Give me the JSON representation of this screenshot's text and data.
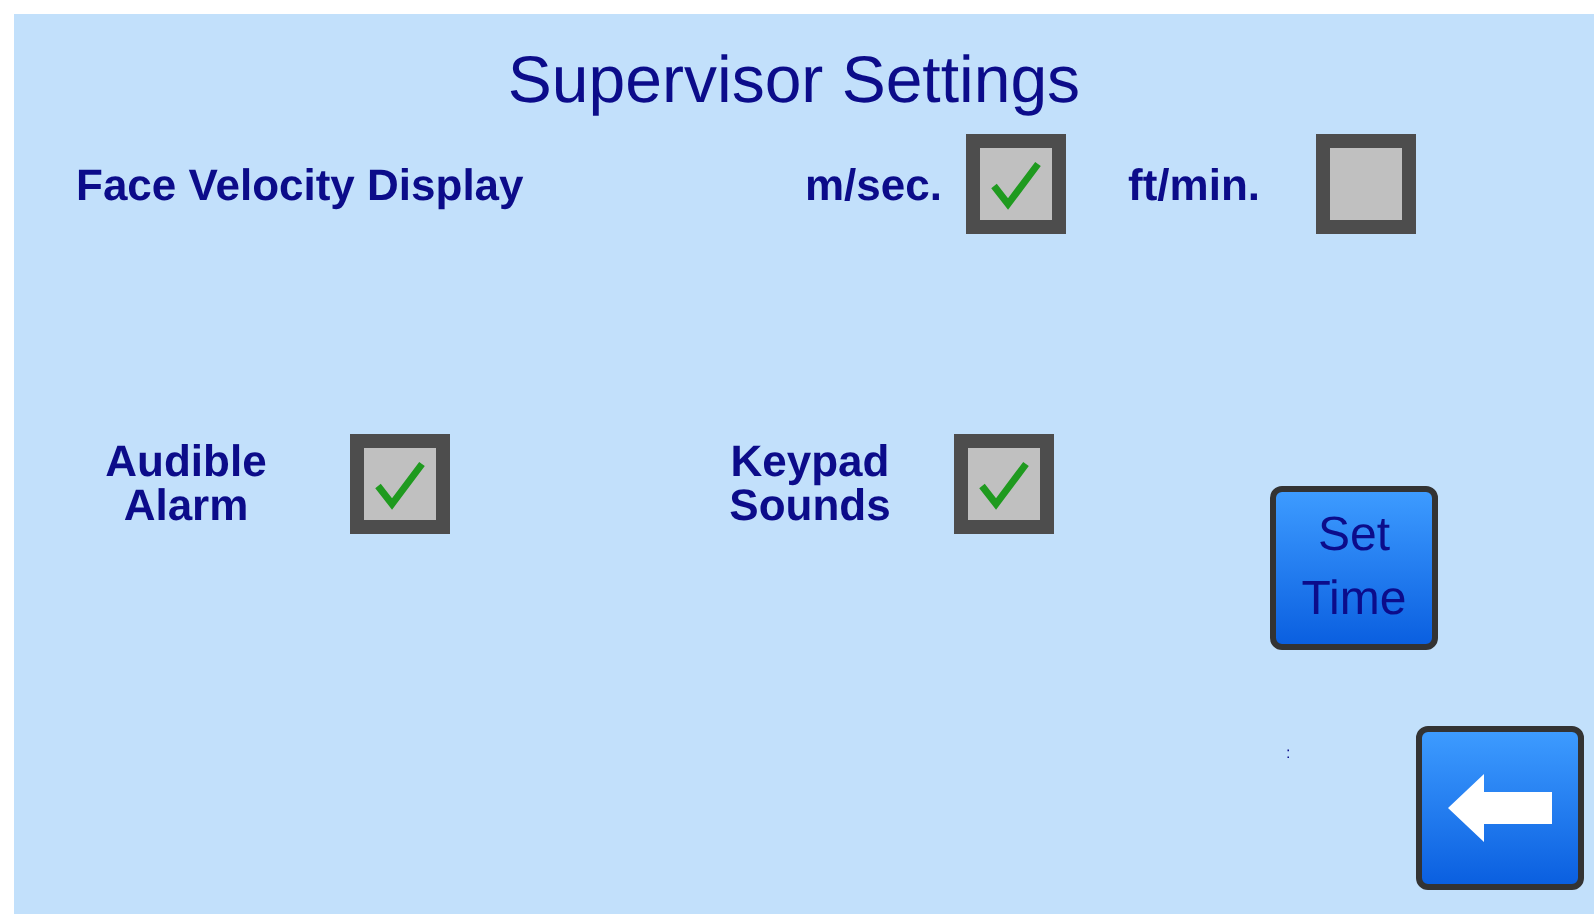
{
  "title": "Supervisor Settings",
  "display": {
    "label": "Face Velocity Display",
    "options": [
      {
        "label": "m/sec.",
        "checked": true
      },
      {
        "label": "ft/min.",
        "checked": false
      }
    ]
  },
  "toggles": [
    {
      "label": "Audible Alarm",
      "checked": true
    },
    {
      "label": "Keypad Sounds",
      "checked": true
    }
  ],
  "set_time_button": "Set Time",
  "separator": ":"
}
